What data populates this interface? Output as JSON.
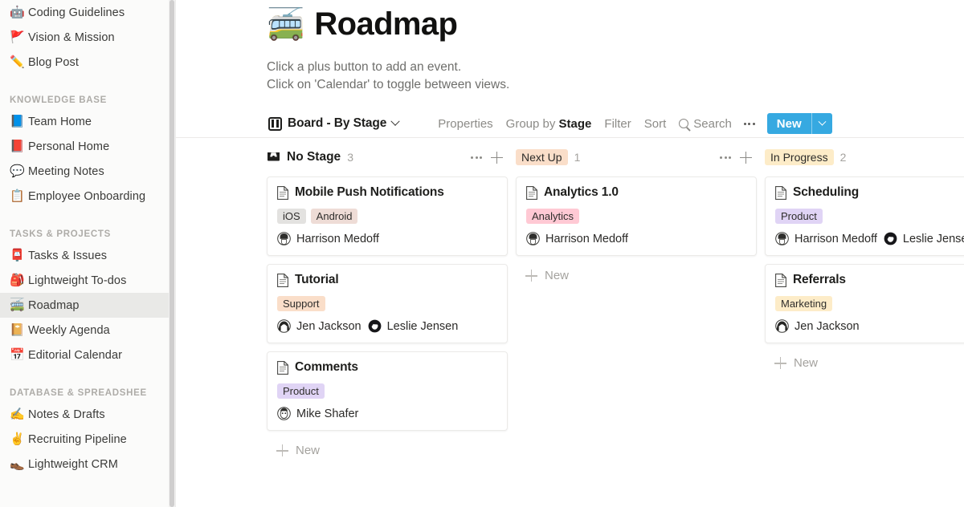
{
  "sidebar": {
    "items": [
      {
        "emoji": "🤖",
        "label": "Coding Guidelines",
        "type": "item",
        "active": false
      },
      {
        "emoji": "🚩",
        "label": "Vision & Mission",
        "type": "item",
        "active": false
      },
      {
        "emoji": "✏️",
        "label": "Blog Post",
        "type": "item",
        "active": false
      },
      {
        "label": "KNOWLEDGE BASE",
        "type": "section"
      },
      {
        "emoji": "📘",
        "label": "Team Home",
        "type": "item",
        "active": false
      },
      {
        "emoji": "📕",
        "label": "Personal Home",
        "type": "item",
        "active": false
      },
      {
        "emoji": "💬",
        "label": "Meeting Notes",
        "type": "item",
        "active": false
      },
      {
        "emoji": "📋",
        "label": "Employee Onboarding",
        "type": "item",
        "active": false
      },
      {
        "label": "TASKS & PROJECTS",
        "type": "section"
      },
      {
        "emoji": "📮",
        "label": "Tasks & Issues",
        "type": "item",
        "active": false
      },
      {
        "emoji": "🎒",
        "label": "Lightweight To-dos",
        "type": "item",
        "active": false
      },
      {
        "emoji": "🚎",
        "label": "Roadmap",
        "type": "item",
        "active": true
      },
      {
        "emoji": "📔",
        "label": "Weekly Agenda",
        "type": "item",
        "active": false
      },
      {
        "emoji": "📅",
        "label": "Editorial Calendar",
        "type": "item",
        "active": false
      },
      {
        "label": "DATABASE & SPREADSHEE",
        "type": "section"
      },
      {
        "emoji": "✍️",
        "label": "Notes & Drafts",
        "type": "item",
        "active": false
      },
      {
        "emoji": "✌️",
        "label": "Recruiting Pipeline",
        "type": "item",
        "active": false
      },
      {
        "emoji": "👞",
        "label": "Lightweight CRM",
        "type": "item",
        "active": false
      }
    ]
  },
  "page": {
    "emoji": "🚎",
    "title": "Roadmap",
    "subtitle_line1": "Click a plus button to add an event.",
    "subtitle_line2": "Click on 'Calendar' to toggle between views."
  },
  "toolbar": {
    "view_icon": "board-icon",
    "view_name": "Board - By Stage",
    "properties_label": "Properties",
    "group_by_prefix": "Group by ",
    "group_by_value": "Stage",
    "filter_label": "Filter",
    "sort_label": "Sort",
    "search_label": "Search",
    "more_label": "•••",
    "new_label": "New",
    "new_accent": "#36a9e1"
  },
  "board": {
    "columns": [
      {
        "title": "No Stage",
        "style": "plain",
        "icon": "inbox-icon",
        "pill_bg": "transparent",
        "count": "3",
        "show_tools": true,
        "add_label": "New",
        "cards": [
          {
            "title": "Mobile Push Notifications",
            "tags": [
              {
                "label": "iOS",
                "bg": "#e3e2e0"
              },
              {
                "label": "Android",
                "bg": "#eedcd6"
              }
            ],
            "people": [
              {
                "name": "Harrison Medoff",
                "avatar": "man-avatar"
              }
            ]
          },
          {
            "title": "Tutorial",
            "tags": [
              {
                "label": "Support",
                "bg": "#fadec9"
              }
            ],
            "people": [
              {
                "name": "Jen Jackson",
                "avatar": "woman-avatar"
              },
              {
                "name": "Leslie Jensen",
                "avatar": "woman-dark-avatar"
              }
            ]
          },
          {
            "title": "Comments",
            "tags": [
              {
                "label": "Product",
                "bg": "#e0d4f5"
              }
            ],
            "people": [
              {
                "name": "Mike Shafer",
                "avatar": "man-pale-avatar"
              }
            ]
          }
        ]
      },
      {
        "title": "Next Up",
        "style": "pill",
        "icon": "",
        "pill_bg": "#fadec9",
        "count": "1",
        "show_tools": true,
        "add_label": "New",
        "cards": [
          {
            "title": "Analytics 1.0",
            "tags": [
              {
                "label": "Analytics",
                "bg": "#ffc9d4"
              }
            ],
            "people": [
              {
                "name": "Harrison Medoff",
                "avatar": "man-avatar"
              }
            ]
          }
        ]
      },
      {
        "title": "In Progress",
        "style": "pill",
        "icon": "",
        "pill_bg": "#fdecc8",
        "count": "2",
        "show_tools": false,
        "add_label": "New",
        "cards": [
          {
            "title": "Scheduling",
            "tags": [
              {
                "label": "Product",
                "bg": "#e0d4f5"
              }
            ],
            "people": [
              {
                "name": "Harrison Medoff",
                "avatar": "man-avatar"
              },
              {
                "name": "Leslie Jensen",
                "avatar": "woman-dark-avatar"
              }
            ]
          },
          {
            "title": "Referrals",
            "tags": [
              {
                "label": "Marketing",
                "bg": "#fdecc8"
              }
            ],
            "people": [
              {
                "name": "Jen Jackson",
                "avatar": "woman-avatar"
              }
            ]
          }
        ]
      }
    ]
  }
}
